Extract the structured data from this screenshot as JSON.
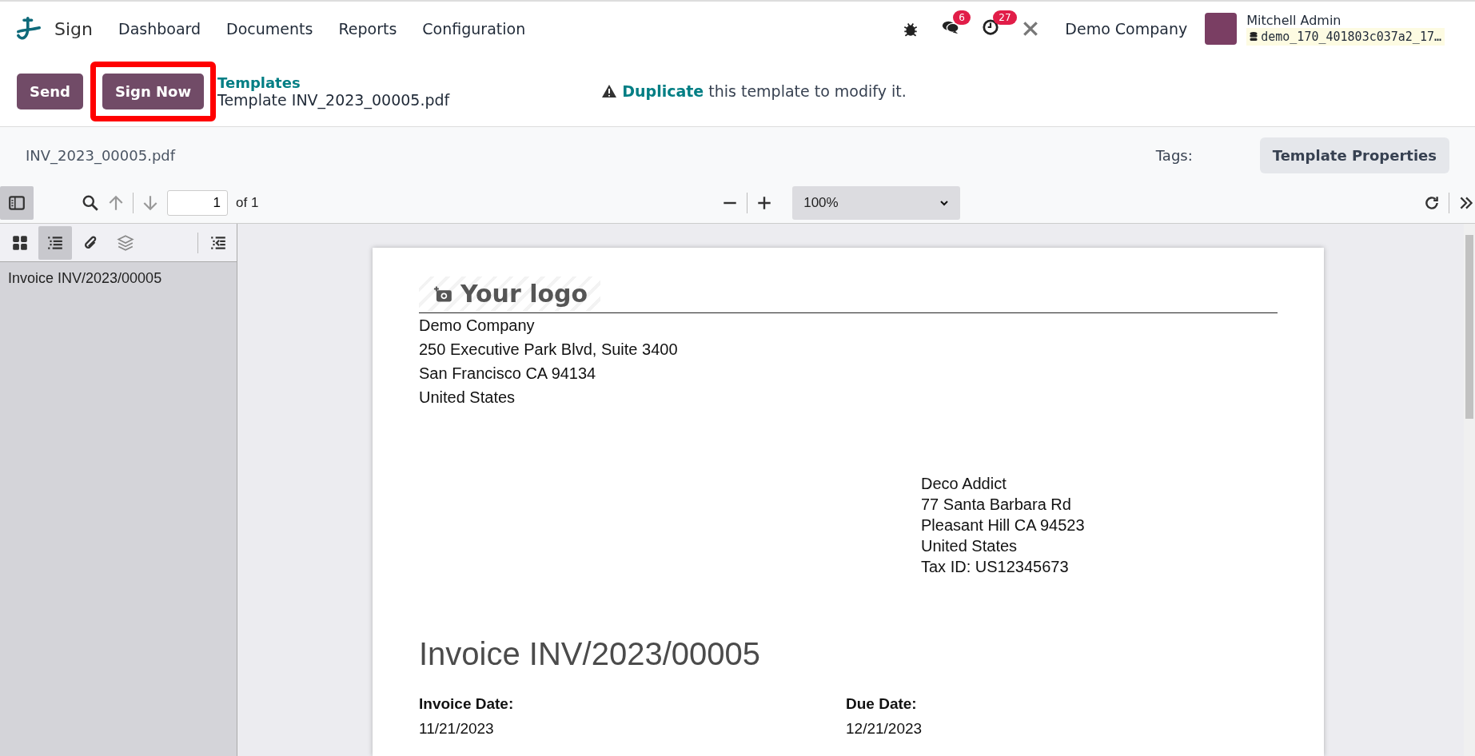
{
  "navbar": {
    "app_name": "Sign",
    "menu": [
      "Dashboard",
      "Documents",
      "Reports",
      "Configuration"
    ],
    "messages_badge": "6",
    "activities_badge": "27",
    "company": "Demo Company",
    "user": "Mitchell Admin",
    "database": "demo_170_401803c037a2_17…"
  },
  "actions": {
    "buttons": [
      {
        "label": "Send",
        "highlighted": false
      },
      {
        "label": "Sign Now",
        "highlighted": true
      }
    ],
    "breadcrumb": "Templates",
    "title": "Template INV_2023_00005.pdf",
    "notice_link": "Duplicate",
    "notice_text": "this template to modify it."
  },
  "document_bar": {
    "filename": "INV_2023_00005.pdf",
    "tags_label": "Tags:",
    "properties_button": "Template Properties"
  },
  "viewer_toolbar": {
    "page": "1",
    "page_count": "of 1",
    "zoom": "100%"
  },
  "sidebar": {
    "views": [
      {
        "kind": "thumbnails",
        "selected": false
      },
      {
        "kind": "outline",
        "selected": true
      },
      {
        "kind": "attachments",
        "selected": false
      },
      {
        "kind": "layers",
        "selected": false
      }
    ],
    "outline": [
      "Invoice INV/2023/00005"
    ]
  },
  "pdf_page": {
    "logo": "Your logo",
    "company_address": [
      "Demo Company",
      "250 Executive Park Blvd, Suite 3400",
      "San Francisco CA 94134",
      "United States"
    ],
    "customer_address": [
      "Deco Addict",
      "77 Santa Barbara Rd",
      "Pleasant Hill CA 94523",
      "United States",
      "Tax ID: US12345673"
    ],
    "heading": "Invoice INV/2023/00005",
    "fields": [
      {
        "label": "Invoice Date:",
        "value": "11/21/2023"
      },
      {
        "label": "Due Date:",
        "value": "12/21/2023"
      }
    ]
  }
}
